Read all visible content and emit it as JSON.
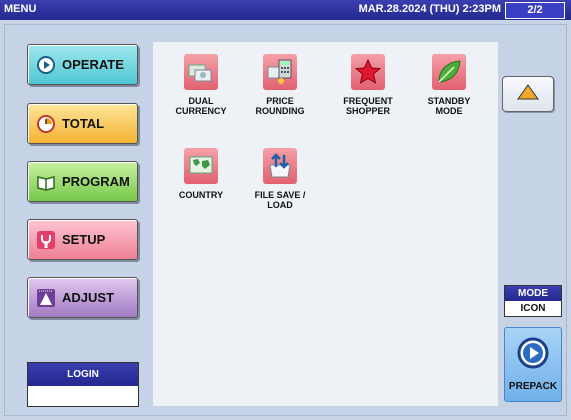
{
  "title_bar": {
    "app_title": "MENU",
    "datetime": "MAR.28.2024 (THU)  2:23PM",
    "page_indicator": "2/2"
  },
  "menu_buttons": [
    {
      "label": "OPERATE",
      "icon": "play-icon",
      "color": "#4fc7d2"
    },
    {
      "label": "TOTAL",
      "icon": "clock-icon",
      "color": "#f3b432"
    },
    {
      "label": "PROGRAM",
      "icon": "book-icon",
      "color": "#77c94b"
    },
    {
      "label": "SETUP",
      "icon": "wrench-icon",
      "color": "#ee7f95"
    },
    {
      "label": "ADJUST",
      "icon": "level-icon",
      "color": "#a07ac2"
    }
  ],
  "login": {
    "label": "LOGIN",
    "value": ""
  },
  "function_tiles": [
    {
      "label_line1": "DUAL",
      "label_line2": "CURRENCY",
      "icon": "currency-icon"
    },
    {
      "label_line1": "PRICE",
      "label_line2": "ROUNDING",
      "icon": "calculator-icon"
    },
    {
      "label_line1": "FREQUENT",
      "label_line2": "SHOPPER",
      "icon": "star-icon"
    },
    {
      "label_line1": "STANDBY",
      "label_line2": "MODE",
      "icon": "leaf-icon"
    },
    {
      "label_line1": "COUNTRY",
      "label_line2": "",
      "icon": "globe-icon"
    },
    {
      "label_line1": "FILE SAVE /",
      "label_line2": "LOAD",
      "icon": "file-transfer-icon"
    }
  ],
  "mode": {
    "label": "MODE",
    "value": "ICON"
  },
  "prepack": {
    "label": "PREPACK"
  },
  "colors": {
    "title_bar": "#24288e",
    "background": "#c9d4e6",
    "tile_icon_bg": "#e8707c"
  }
}
